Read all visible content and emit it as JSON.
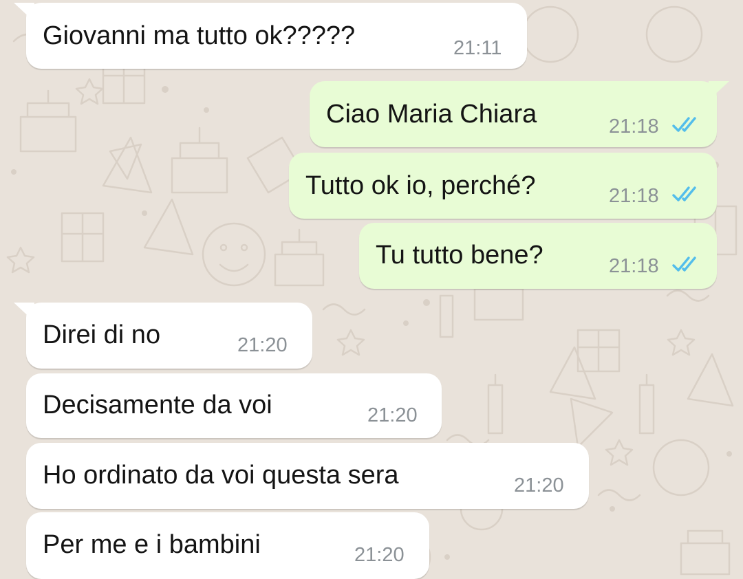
{
  "chat": {
    "messages": [
      {
        "direction": "incoming",
        "text": "Giovanni ma tutto ok?????",
        "time": "21:11"
      },
      {
        "direction": "outgoing",
        "text": "Ciao Maria Chiara",
        "time": "21:18",
        "status_icon": "double-check-read-icon"
      },
      {
        "direction": "outgoing",
        "text": "Tutto ok io, perché?",
        "time": "21:18",
        "status_icon": "double-check-read-icon"
      },
      {
        "direction": "outgoing",
        "text": "Tu tutto bene?",
        "time": "21:18",
        "status_icon": "double-check-read-icon"
      },
      {
        "direction": "incoming",
        "text": "Direi di no",
        "time": "21:20"
      },
      {
        "direction": "incoming",
        "text": "Decisamente da voi",
        "time": "21:20"
      },
      {
        "direction": "incoming",
        "text": "Ho ordinato da voi questa sera",
        "time": "21:20"
      },
      {
        "direction": "incoming",
        "text": "Per me e i bambini",
        "time": "21:20"
      }
    ]
  },
  "colors": {
    "background": "#e9e2da",
    "incoming_bubble": "#ffffff",
    "outgoing_bubble": "#e8fcd5",
    "read_ticks": "#53bdeb",
    "timestamp": "#8b9196",
    "doodle": "#d8cfc5"
  }
}
